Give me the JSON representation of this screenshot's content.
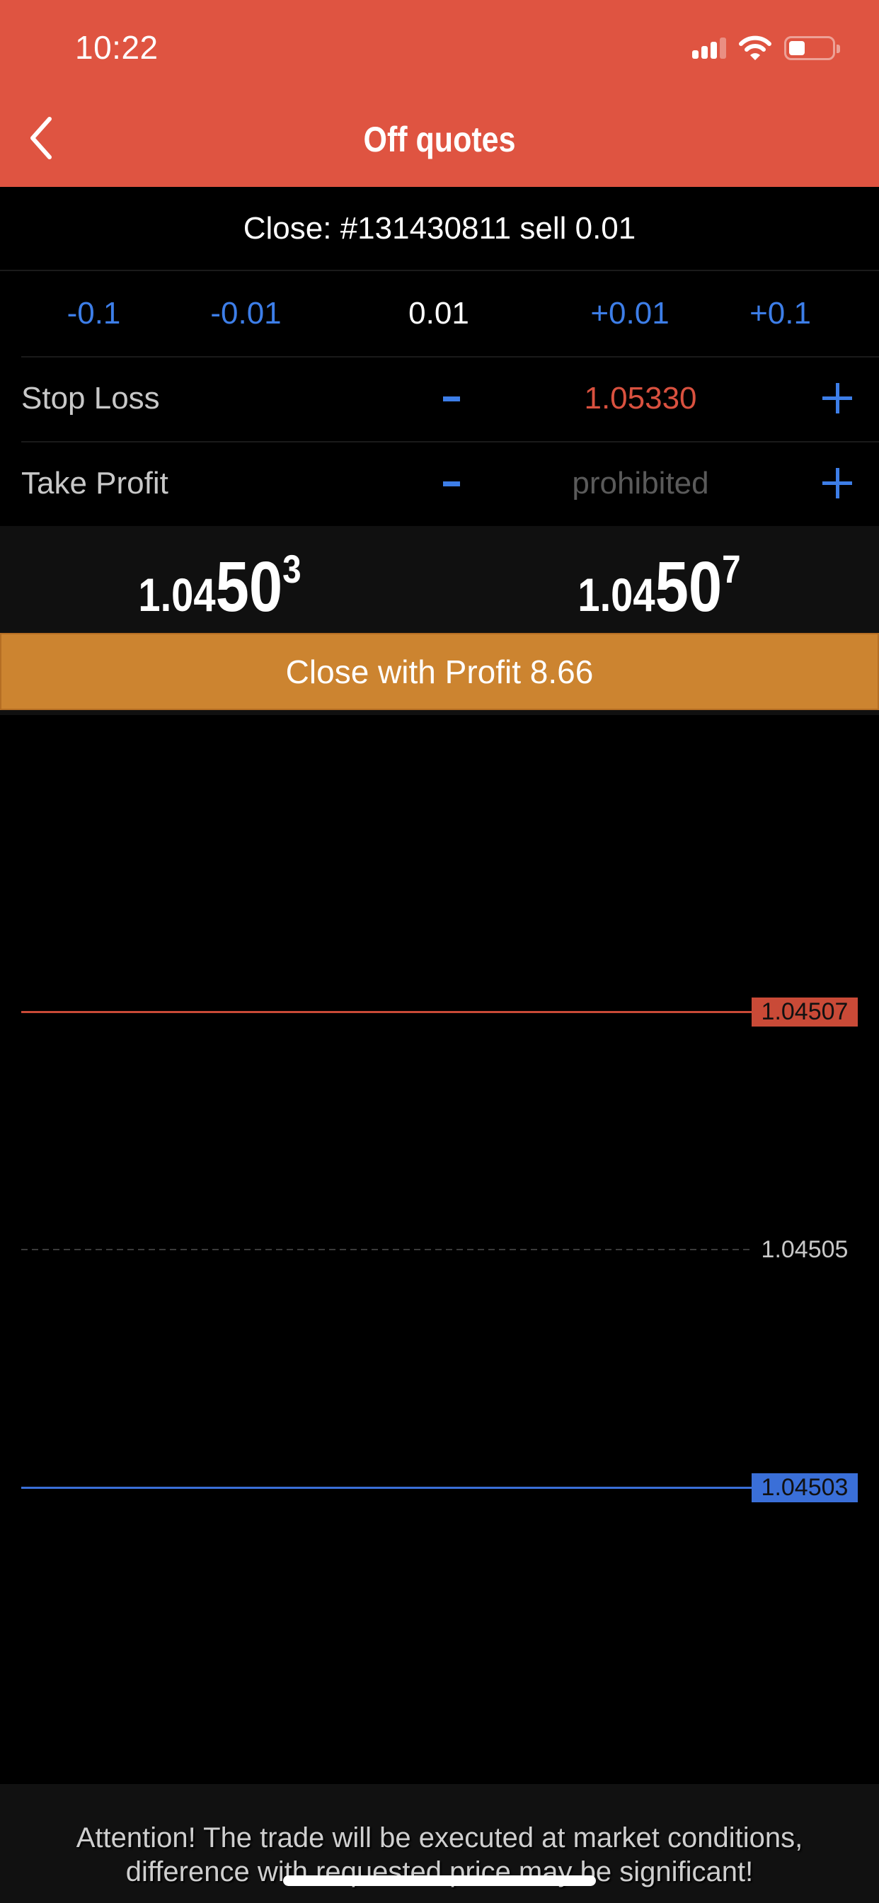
{
  "status_bar": {
    "time": "10:22",
    "icons": [
      "signal-icon",
      "wifi-icon",
      "battery-icon"
    ]
  },
  "header": {
    "title": "Off quotes",
    "back_icon": "chevron-left-icon",
    "background_color": "#df5441"
  },
  "order": {
    "close_label": "Close: #131430811 sell 0.01"
  },
  "volume": {
    "buttons": [
      "-0.1",
      "-0.01",
      "0.01",
      "+0.01",
      "+0.1"
    ],
    "current": "0.01"
  },
  "stop_loss": {
    "label": "Stop Loss",
    "value": "1.05330",
    "minus_icon": "minus-icon",
    "plus_icon": "plus-icon",
    "value_color": "#d9513f"
  },
  "take_profit": {
    "label": "Take Profit",
    "value": "prohibited",
    "minus_icon": "minus-icon",
    "plus_icon": "plus-icon",
    "value_color": "#5a5a5a"
  },
  "prices": {
    "bid": {
      "small": "1.04",
      "big": "50",
      "sup": "3",
      "full": "1.04503"
    },
    "ask": {
      "small": "1.04",
      "big": "50",
      "sup": "7",
      "full": "1.04507"
    }
  },
  "close_button": {
    "label": "Close with Profit 8.66",
    "color": "#cc8430"
  },
  "chart_data": {
    "type": "line",
    "title": "",
    "ylim": [
      1.045005,
      1.045095
    ],
    "levels": [
      {
        "name": "ask",
        "value": 1.04507,
        "label": "1.04507",
        "color": "#c94a37",
        "style": "solid"
      },
      {
        "name": "mid",
        "value": 1.04505,
        "label": "1.04505",
        "color": "#3a3a3a",
        "style": "dashed"
      },
      {
        "name": "bid",
        "value": 1.04503,
        "label": "1.04503",
        "color": "#3a6fd8",
        "style": "solid"
      }
    ]
  },
  "attention": {
    "line1": "Attention! The trade will be executed at market conditions,",
    "line2": "difference with requested price may be significant!"
  }
}
